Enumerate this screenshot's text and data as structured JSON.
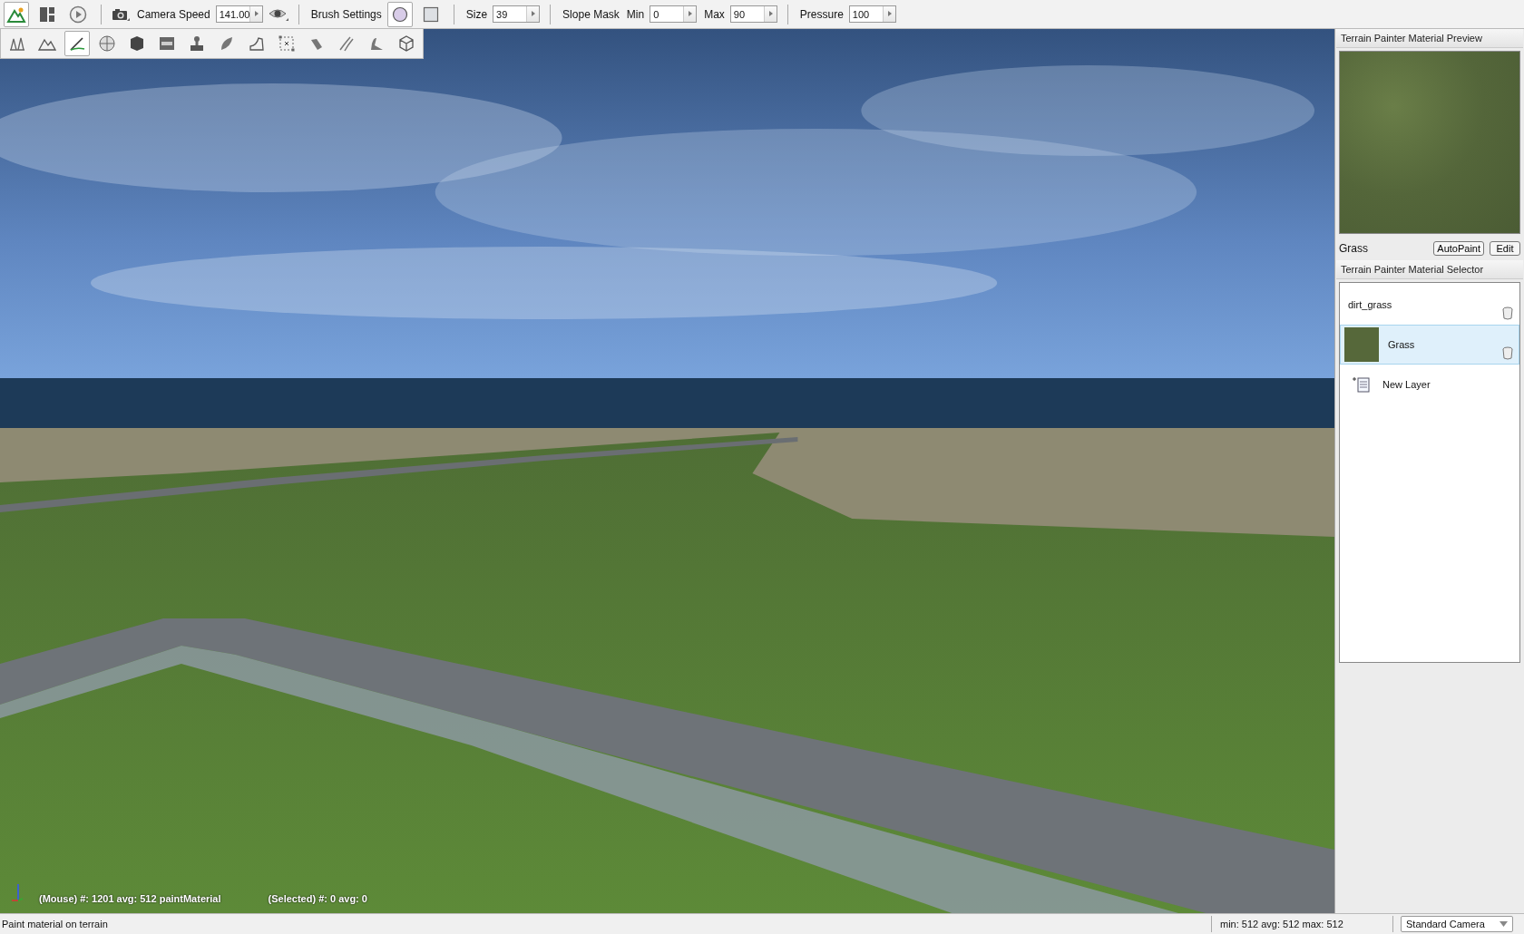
{
  "toolbar": {
    "mode_buttons": [
      {
        "selected": true
      },
      {
        "selected": false
      },
      {
        "selected": false
      }
    ],
    "camera_speed": {
      "label": "Camera Speed",
      "value": "141.00"
    },
    "brush_settings": {
      "label": "Brush Settings",
      "shapes": [
        {
          "kind": "circle",
          "selected": true
        },
        {
          "kind": "square",
          "selected": false
        }
      ]
    },
    "size": {
      "label": "Size",
      "value": "39"
    },
    "slope_mask": {
      "label": "Slope Mask",
      "min_label": "Min",
      "min": "0",
      "max_label": "Max",
      "max": "90"
    },
    "pressure": {
      "label": "Pressure",
      "value": "100"
    }
  },
  "tools": [
    {
      "selected": false
    },
    {
      "selected": false
    },
    {
      "selected": true
    },
    {
      "selected": false
    },
    {
      "selected": false
    },
    {
      "selected": false
    },
    {
      "selected": false
    },
    {
      "selected": false
    },
    {
      "selected": false
    },
    {
      "selected": false
    },
    {
      "selected": false
    },
    {
      "selected": false
    },
    {
      "selected": false
    },
    {
      "selected": false
    }
  ],
  "viewport": {
    "mouse_info": "(Mouse) #: 1201  avg: 512 paintMaterial",
    "selected_info": "(Selected) #: 0  avg: 0"
  },
  "preview_panel": {
    "title": "Terrain Painter Material Preview",
    "material_name": "Grass",
    "buttons": [
      "AutoPaint",
      "Edit"
    ]
  },
  "selector_panel": {
    "title": "Terrain Painter Material Selector",
    "materials": [
      {
        "name": "dirt_grass",
        "kind": "plain",
        "selected": false
      },
      {
        "name": "Grass",
        "kind": "textured",
        "selected": true
      }
    ],
    "new_layer": "New Layer"
  },
  "status_bar": {
    "message": "Paint material on terrain",
    "stats": "min: 512  avg: 512  max: 512",
    "camera": "Standard Camera"
  }
}
